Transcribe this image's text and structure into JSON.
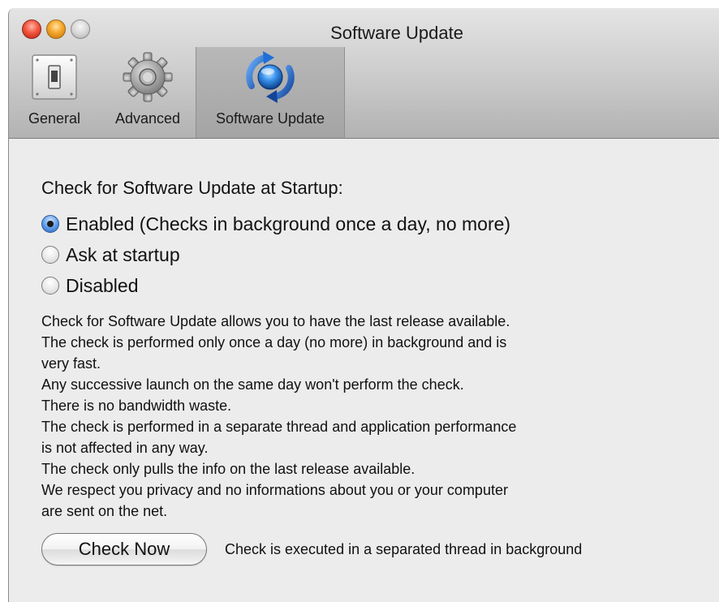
{
  "window": {
    "title": "Software Update"
  },
  "toolbar": {
    "items": [
      {
        "label": "General",
        "icon": "switch-icon"
      },
      {
        "label": "Advanced",
        "icon": "gear-icon"
      },
      {
        "label": "Software Update",
        "icon": "update-icon",
        "selected": true
      }
    ]
  },
  "content": {
    "heading": "Check for Software Update at Startup:",
    "options": [
      {
        "label": "Enabled (Checks in background once a day, no more)",
        "selected": true
      },
      {
        "label": "Ask at startup",
        "selected": false
      },
      {
        "label": "Disabled",
        "selected": false
      }
    ],
    "description_lines": [
      "Check for Software Update allows you to have the last release available.",
      "The check is performed only once a day (no more) in background and is",
      "very fast.",
      "Any successive launch on the same day won't perform the check.",
      "There is no bandwidth waste.",
      "The check is performed in a separate thread and application performance",
      "is not affected in any way.",
      "The check only pulls the info on the last release available.",
      "We respect you privacy and no informations about you or your computer",
      "are sent on the net."
    ],
    "check_button": "Check Now",
    "check_note": "Check is executed in a separated thread in background"
  },
  "colors": {
    "window_bg": "#ececec",
    "selected_radio": "#5a9ae8",
    "update_icon_blue": "#1f6fd6"
  }
}
